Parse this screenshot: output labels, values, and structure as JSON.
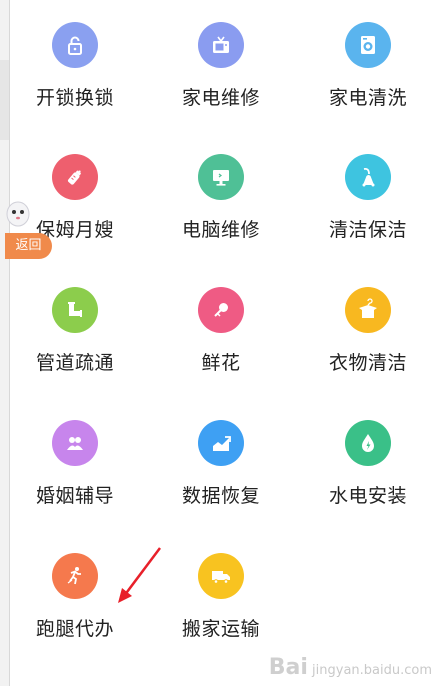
{
  "colors": {
    "lock": "#8aa0f0",
    "tv": "#8a9cf0",
    "washer": "#5ab4ee",
    "bottle": "#ee5f6e",
    "monitor": "#4fc096",
    "vacuum": "#3ec4e0",
    "pipe": "#8ccd4c",
    "flower": "#ef5b84",
    "shirt": "#f8b820",
    "couple": "#c785ec",
    "chart": "#3ea0f3",
    "drop": "#3ac088",
    "runner": "#f5794d",
    "truck": "#f8c320",
    "badge": "#f08a4b",
    "arrow": "#e8202a"
  },
  "services": [
    {
      "label": "开锁换锁",
      "icon": "lock-icon"
    },
    {
      "label": "家电维修",
      "icon": "tv-icon"
    },
    {
      "label": "家电清洗",
      "icon": "washing-machine-icon"
    },
    {
      "label": "保姆月嫂",
      "icon": "baby-bottle-icon"
    },
    {
      "label": "电脑维修",
      "icon": "monitor-icon"
    },
    {
      "label": "清洁保洁",
      "icon": "vacuum-icon"
    },
    {
      "label": "管道疏通",
      "icon": "pipe-icon"
    },
    {
      "label": "鲜花",
      "icon": "flower-icon"
    },
    {
      "label": "衣物清洁",
      "icon": "shirt-icon"
    },
    {
      "label": "婚姻辅导",
      "icon": "couple-icon"
    },
    {
      "label": "数据恢复",
      "icon": "chart-icon"
    },
    {
      "label": "水电安装",
      "icon": "water-drop-icon"
    },
    {
      "label": "跑腿代办",
      "icon": "runner-icon"
    },
    {
      "label": "搬家运输",
      "icon": "truck-icon"
    }
  ],
  "back_button": {
    "label": "返回"
  },
  "annotation": {
    "icon": "red-arrow-icon"
  },
  "watermark": {
    "logo": "Bai",
    "text": "jingyan.baidu.com"
  }
}
